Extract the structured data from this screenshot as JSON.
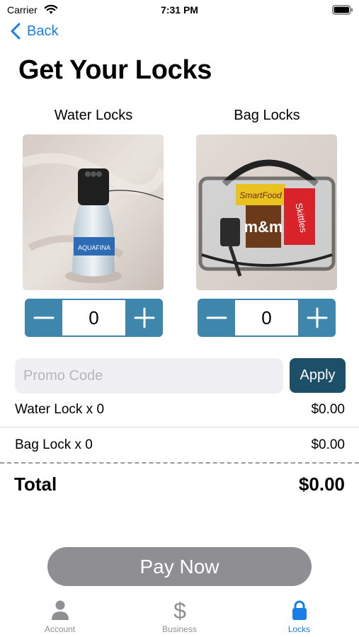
{
  "status_bar": {
    "carrier": "Carrier",
    "time": "7:31 PM"
  },
  "nav": {
    "back_label": "Back"
  },
  "page": {
    "title": "Get Your Locks"
  },
  "products": [
    {
      "label": "Water Locks",
      "quantity": "0",
      "image_icon": "water-bottle-lock-photo"
    },
    {
      "label": "Bag Locks",
      "quantity": "0",
      "image_icon": "clear-bag-lock-photo"
    }
  ],
  "promo": {
    "placeholder": "Promo Code",
    "value": "",
    "apply_label": "Apply"
  },
  "summary": {
    "items": [
      {
        "label": "Water Lock x 0",
        "price": "$0.00"
      },
      {
        "label": "Bag Lock x 0",
        "price": "$0.00"
      }
    ],
    "total_label": "Total",
    "total_value": "$0.00"
  },
  "pay_button_label": "Pay Now",
  "tabs": [
    {
      "label": "Account",
      "icon": "person-icon"
    },
    {
      "label": "Business",
      "icon": "dollar-icon"
    },
    {
      "label": "Locks",
      "icon": "lock-icon",
      "active": true
    }
  ],
  "colors": {
    "accent": "#1a7ee8",
    "stepper": "#3f86ad",
    "apply": "#1d4f68",
    "pay_disabled": "#8e8e93"
  }
}
